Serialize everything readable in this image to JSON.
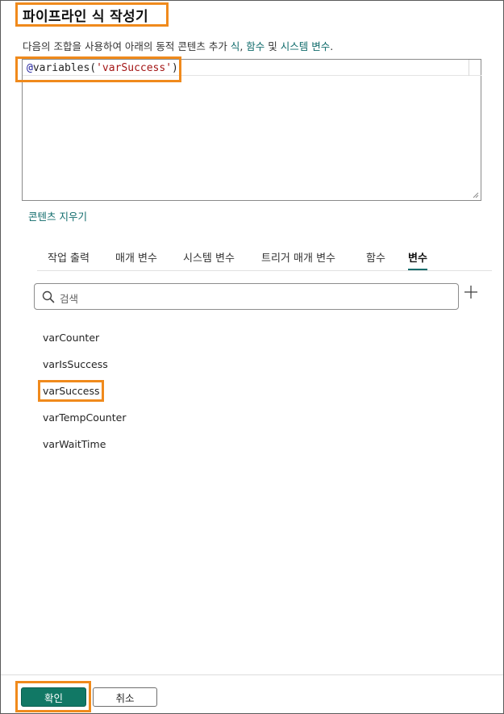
{
  "dialog": {
    "title": "파이프라인 식 작성기",
    "description": {
      "prefix": "다음의 조합을 사용하여 아래의 동적 콘텐츠 추가 ",
      "link1": "식",
      "sep1": ", ",
      "link2": "함수",
      "sep2": " 및 ",
      "link3": "시스템 변수",
      "suffix": "."
    }
  },
  "editor": {
    "code_at": "@",
    "code_fn": "variables(",
    "code_arg": "'varSuccess'",
    "code_close": ")"
  },
  "clear_content_label": "콘텐츠 지우기",
  "tabs": [
    {
      "label": "작업 출력"
    },
    {
      "label": "매개 변수"
    },
    {
      "label": "시스템 변수"
    },
    {
      "label": "트리거 매개 변수"
    },
    {
      "label": "함수"
    },
    {
      "label": "변수",
      "active": true
    }
  ],
  "search": {
    "placeholder": "검색",
    "icon": "search-icon"
  },
  "add_icon": "plus-icon",
  "variables": [
    {
      "label": "varCounter"
    },
    {
      "label": "varIsSuccess"
    },
    {
      "label": "varSuccess",
      "highlighted": true
    },
    {
      "label": "varTempCounter"
    },
    {
      "label": "varWaitTime"
    }
  ],
  "footer": {
    "ok_label": "확인",
    "cancel_label": "취소"
  },
  "colors": {
    "accent": "#117865",
    "link": "#0f6b6b",
    "highlight": "#f08a1c"
  }
}
